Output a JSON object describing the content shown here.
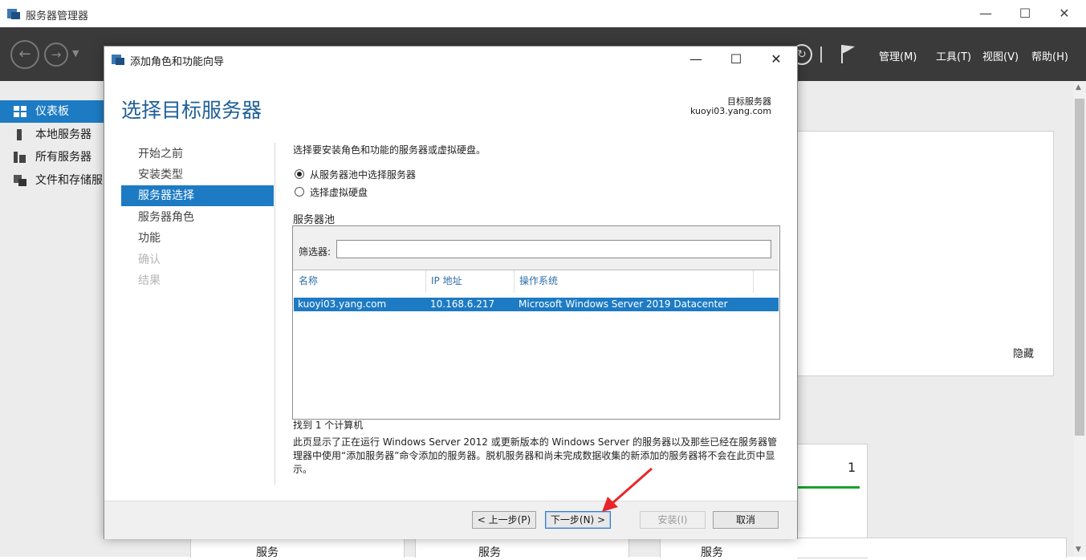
{
  "outer": {
    "title": "服务器管理器",
    "menu": [
      "管理(M)",
      "工具(T)",
      "视图(V)",
      "帮助(H)"
    ],
    "sidebar": [
      "仪表板",
      "本地服务器",
      "所有服务器",
      "文件和存储服"
    ],
    "hide_link": "隐藏",
    "tile_count": "1",
    "bottom_tiles": [
      "服务",
      "服务",
      "服务"
    ],
    "accent_color": "#1d7bc4",
    "status_color": "#19a12a"
  },
  "dialog": {
    "title": "添加角色和功能向导",
    "heading": "选择目标服务器",
    "target_label": "目标服务器",
    "target_value": "kuoyi03.yang.com",
    "steps": [
      {
        "label": "开始之前",
        "state": "done"
      },
      {
        "label": "安装类型",
        "state": "done"
      },
      {
        "label": "服务器选择",
        "state": "active"
      },
      {
        "label": "服务器角色",
        "state": "done"
      },
      {
        "label": "功能",
        "state": "done"
      },
      {
        "label": "确认",
        "state": "disabled"
      },
      {
        "label": "结果",
        "state": "disabled"
      }
    ],
    "instruction": "选择要安装角色和功能的服务器或虚拟硬盘。",
    "radio_pool": "从服务器池中选择服务器",
    "radio_vhd": "选择虚拟硬盘",
    "pool_label": "服务器池",
    "filter_label": "筛选器:",
    "filter_value": "",
    "columns": [
      "名称",
      "IP 地址",
      "操作系统"
    ],
    "rows": [
      {
        "name": "kuoyi03.yang.com",
        "ip": "10.168.6.217",
        "os": "Microsoft Windows Server 2019 Datacenter"
      }
    ],
    "found": "找到 1 个计算机",
    "note": "此页显示了正在运行 Windows Server 2012 或更新版本的 Windows Server 的服务器以及那些已经在服务器管理器中使用“添加服务器”命令添加的服务器。脱机服务器和尚未完成数据收集的新添加的服务器将不会在此页中显示。",
    "buttons": {
      "prev": "< 上一步(P)",
      "next": "下一步(N) >",
      "install": "安装(I)",
      "cancel": "取消"
    }
  }
}
